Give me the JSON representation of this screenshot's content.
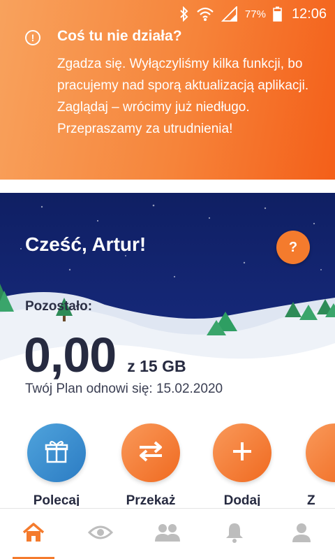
{
  "status_bar": {
    "battery_percent": "77%",
    "time": "12:06",
    "icons": [
      "bluetooth-icon",
      "wifi-icon",
      "signal-icon",
      "battery-icon"
    ]
  },
  "notice": {
    "icon": "info-icon",
    "title": "Coś tu nie działa?",
    "body": "Zgadza się. Wyłączyliśmy kilka funkcji, bo pracujemy nad sporą aktualizacją aplikacji. Zaglądaj – wrócimy już niedługo. Przepraszamy za utrudnienia!"
  },
  "hero": {
    "greeting": "Cześć, Artur!",
    "help_label": "?",
    "remaining_label": "Pozostało:",
    "data_value": "0,00",
    "data_total": "z 15 GB",
    "renew_text": "Twój Plan odnowi się: 15.02.2020"
  },
  "actions": [
    {
      "label": "Polecaj",
      "icon": "gift-icon"
    },
    {
      "label": "Przekaż",
      "icon": "transfer-arrows-icon"
    },
    {
      "label": "Dodaj",
      "icon": "plus-icon"
    },
    {
      "label": "Z",
      "icon": "more-icon"
    }
  ],
  "bottom_nav": [
    {
      "icon": "home-icon",
      "active": true
    },
    {
      "icon": "eye-icon",
      "active": false
    },
    {
      "icon": "people-icon",
      "active": false
    },
    {
      "icon": "bell-icon",
      "active": false
    },
    {
      "icon": "profile-icon",
      "active": false
    }
  ],
  "colors": {
    "accent": "#f47b2d",
    "hero_sky": "#16297a",
    "text_dark": "#262a40",
    "polecaj_blue": "#2c7cc3"
  }
}
